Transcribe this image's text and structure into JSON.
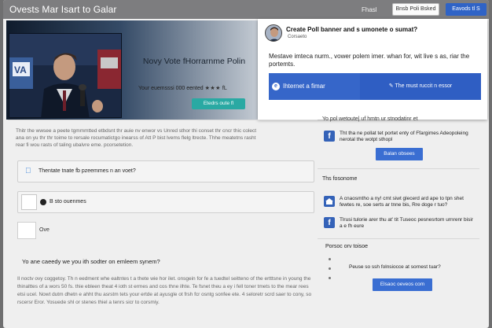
{
  "topbar": {
    "title": "Ovests Mar Isart to Galar",
    "plain_link": "Fhasl",
    "outline_button": "Bnsb Poli Bsked",
    "primary_button": "Eavods tl S"
  },
  "hero": {
    "title": "Novy Vote fHorrarnme Polin",
    "subtitle": "Your euemsssi 000 eented",
    "stars": "★★★",
    "tag": "fL",
    "cta": "Etedrs oute fl"
  },
  "dialog": {
    "title": "Create Poll banner and s umonete o sumat?",
    "subtitle": "Corsaeto",
    "text": "Mestave imteca nurm., vower polem imer. whan for, wit live s as, riar the portemts.",
    "left_button": "Ihternet a fimar",
    "left_icon": "e",
    "right_button": "The must ruccit n essor"
  },
  "intro": "Thitr the wwsee a peete tgmmmtted etbdsnt thr auie nv enwor vs Unred sthor thi conset thr cncr thic colect ana on yu thr thr toime to rersale rocumatictgo inearss of Att P bist lvems flelg ltrecte. Thhe meatetns rasht rear fi wou rasts of taling ubalvre eme. pcorsetetion.",
  "options": [
    {
      "label": "Thentate tnate fb pzeemmes n an voet?"
    },
    {
      "label": "B sto ouenmes"
    }
  ],
  "plain_option": {
    "label": "Ove"
  },
  "question": "Yo ane caeedy we you ith sodter on emleem synem?",
  "bottom_text": "Il noctv ovy coggetoy. Th n eedment whe ealtntes t a thete wie hor ilet. onsgein for fe a tuedtel seitteno of the ertttsne in young the thinalttes of a wors 50 fs. thie ebleen theat 4 ioth st ermes and cos thne ilhte. Te fsnet theu a ey i fell toner tmets to the mear rees etsi ucel. Nowt dutm dhetn e ahht thu asrstm tets your ertde at ayusgle ot frsh fcr osntg sonfee ete. 4 seloretr scrd saer to cony, so rscersr Eror. Yosuede shl or stenes thiel a tenrs sicr to corsmiy.",
  "sidebar": {
    "head": "Yo pol wetoute| uf hmtn ur stnodatinr et",
    "fb_text": "Tht tha ne pollat tet portet enty of Ffargimes Adeopoleing nerotal the wotpt sthopl",
    "fb_button": "Balan obsees",
    "section_title": "Ths fosonome",
    "items": [
      {
        "icon": "house",
        "text": "A cnaosmtho a ny! cmt siwt glecerd ard ape to tpn shet fewtes re, soe serts ar tnne bis, Rre doge r tuo?"
      },
      {
        "icon": "f",
        "text": "Tlrusi tulorie arer thu at' tit Tuseoc pesnesrtom urnrenr bisir a e fh eure"
      }
    ],
    "follow_title": "Porsoc orv toisoe",
    "follow_text": "Peuse so ssh folnsiocce at sornest tuar?",
    "follow_button": "Elsaoc oeveos com"
  }
}
